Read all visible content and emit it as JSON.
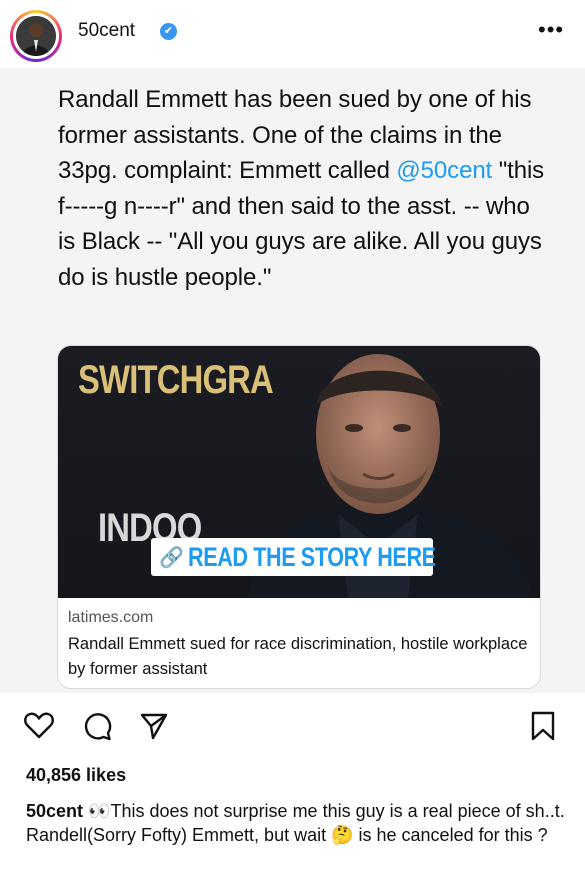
{
  "header": {
    "username": "50cent",
    "verified_icon": "✔",
    "more_label": "•••"
  },
  "tweet": {
    "text_before": "Randall Emmett has been sued by one of his former assistants. One of the claims in the 33pg. complaint: Emmett called ",
    "mention": "@50cent",
    "text_after": " \"this f-----g n----r\" and then said to the asst. -- who is Black -- \"All you guys are alike. All you guys do is hustle people.\""
  },
  "card": {
    "image_text_top": "SWITCHGRA",
    "image_text_bottom": "INDOO",
    "link_icon": "🔗",
    "read_story_label": "READ THE STORY HERE",
    "domain": "latimes.com",
    "title": "Randall Emmett sued for race discrimination, hostile workplace by former assistant"
  },
  "actions": {
    "like_icon": "heart-icon",
    "comment_icon": "comment-icon",
    "share_icon": "send-icon",
    "save_icon": "bookmark-icon"
  },
  "likes": "40,856 likes",
  "caption": {
    "username": "50cent",
    "eyes_emoji": "👀",
    "text": "This does not surprise me this guy is a real piece of sh..t. Randell(Sorry Fofty) Emmett, but wait ",
    "thinking_emoji": "🤔",
    "text_end": " is he canceled for this ?"
  },
  "colors": {
    "mention": "#1d9bf0",
    "verified": "#3897f0",
    "card_border": "#d9d9d9",
    "post_bg": "#f4f4f4"
  }
}
